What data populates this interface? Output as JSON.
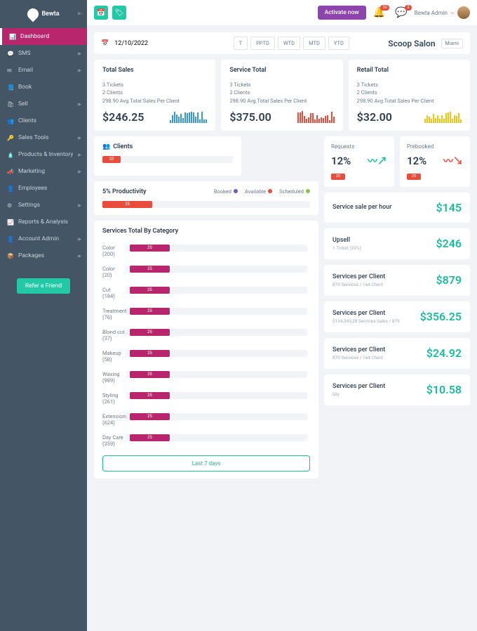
{
  "brand": "Bewta",
  "topbar": {
    "activate": "Activate now",
    "bell_count": "30",
    "chat_count": "3",
    "user": "Bewta Admin"
  },
  "nav": [
    {
      "icon": "📊",
      "label": "Dashboard",
      "active": true
    },
    {
      "icon": "💬",
      "label": "SMS",
      "chev": true
    },
    {
      "icon": "✉",
      "label": "Email",
      "chev": true
    },
    {
      "icon": "📘",
      "label": "Book"
    },
    {
      "icon": "🛍",
      "label": "Sell",
      "chev": true
    },
    {
      "icon": "👥",
      "label": "Clients"
    },
    {
      "icon": "🔑",
      "label": "Sales Tools",
      "chev": true
    },
    {
      "icon": "🧴",
      "label": "Products & Inventory",
      "chev": true
    },
    {
      "icon": "📣",
      "label": "Marketing",
      "chev": true
    },
    {
      "icon": "👤",
      "label": "Employees"
    },
    {
      "icon": "⚙",
      "label": "Settings",
      "chev": true
    },
    {
      "icon": "📈",
      "label": "Reports & Analysis"
    },
    {
      "icon": "👤",
      "label": "Account Admin",
      "chev": true
    },
    {
      "icon": "📦",
      "label": "Packages",
      "chev": true
    }
  ],
  "refer": "Refer a Friend",
  "date": "12/10/2022",
  "periods": [
    "T",
    "PPTD",
    "WTD",
    "MTD",
    "YTD"
  ],
  "salon": {
    "name": "Scoop Salon",
    "loc": "Miami"
  },
  "kpis": [
    {
      "title": "Total Sales",
      "l1": "3 Tickets",
      "l2": "2 Clients",
      "l3": "298.90 Avg Total Sales Per Client",
      "val": "$246.25",
      "color": "blue"
    },
    {
      "title": "Service Total",
      "l1": "3 Tickets",
      "l2": "2 Clients",
      "l3": "298.90 Avg Total Sales Per Client",
      "val": "$375.00",
      "color": "red"
    },
    {
      "title": "Retail Total",
      "l1": "3 Tickets",
      "l2": "2 Clients",
      "l3": "298.90 Avg Total Sales Per Client",
      "val": "$32.00",
      "color": "yel"
    }
  ],
  "clients": {
    "title": "Clients",
    "val": "33"
  },
  "prod": {
    "title": "5% Productivity",
    "booked": "Booked",
    "available": "Available",
    "scheduled": "Scheduled",
    "val": "25"
  },
  "requests": {
    "label": "Requests",
    "val": "12%",
    "tag": "25"
  },
  "prebooked": {
    "label": "Prebooked",
    "val": "12%",
    "tag": "25"
  },
  "stats": [
    {
      "label": "Service sale per hour",
      "sub": "",
      "val": "$145"
    },
    {
      "label": "Upsell",
      "sub": "1 Ticket (33%)",
      "val": "$246"
    },
    {
      "label": "Services per Client",
      "sub": "879 Services / 164 Client",
      "val": "$879"
    },
    {
      "label": "Services per Client",
      "sub": "$154,549,28 Services Sales / 879",
      "val": "$356.25"
    },
    {
      "label": "Services per Client",
      "sub": "879 Services / 164 Client",
      "val": "$24.92"
    },
    {
      "label": "Services per Client",
      "sub": "Qty",
      "val": "$10.58"
    }
  ],
  "svc": {
    "title": "Services Total By Category",
    "last7": "Last 7 days",
    "items": [
      {
        "name": "Color",
        "count": "(200)",
        "val": "25"
      },
      {
        "name": "Color",
        "count": "(20)",
        "val": "25"
      },
      {
        "name": "Cut",
        "count": "(184)",
        "val": "25"
      },
      {
        "name": "Treatment",
        "count": "(76)",
        "val": "25"
      },
      {
        "name": "Blond cut",
        "count": "(37)",
        "val": "25"
      },
      {
        "name": "Makeup",
        "count": "(58)",
        "val": "25"
      },
      {
        "name": "Waxing",
        "count": "(989)",
        "val": "25"
      },
      {
        "name": "Styling",
        "count": "(261)",
        "val": "25"
      },
      {
        "name": "Extensions",
        "count": "(624)",
        "val": "25"
      },
      {
        "name": "Day Care",
        "count": "(359)",
        "val": "25"
      }
    ]
  },
  "chart_data": {
    "type": "bar",
    "title": "Services Total By Category",
    "categories": [
      "Color",
      "Color",
      "Cut",
      "Treatment",
      "Blond cut",
      "Makeup",
      "Waxing",
      "Styling",
      "Extensions",
      "Day Care"
    ],
    "values": [
      25,
      25,
      25,
      25,
      25,
      25,
      25,
      25,
      25,
      25
    ]
  }
}
